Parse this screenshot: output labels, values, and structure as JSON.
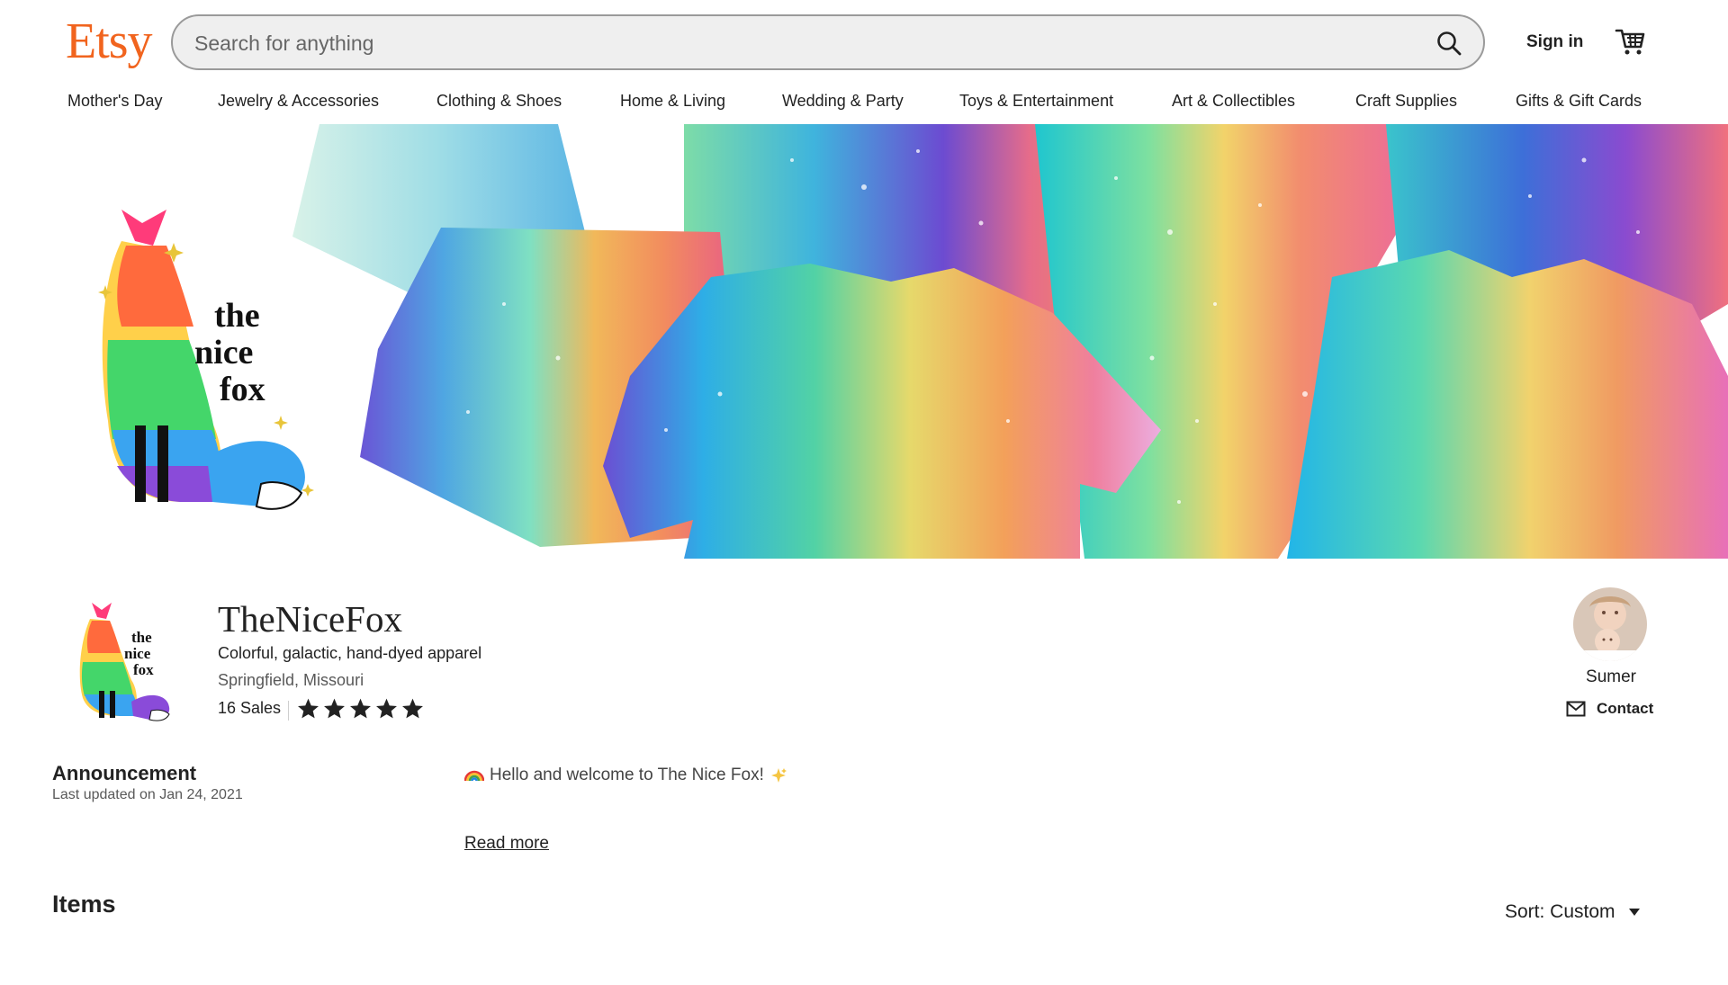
{
  "header": {
    "logo": "Etsy",
    "search_placeholder": "Search for anything",
    "sign_in": "Sign in"
  },
  "nav": {
    "items": [
      "Mother's Day",
      "Jewelry & Accessories",
      "Clothing & Shoes",
      "Home & Living",
      "Wedding & Party",
      "Toys & Entertainment",
      "Art & Collectibles",
      "Craft Supplies",
      "Gifts & Gift Cards"
    ]
  },
  "banner": {
    "logo_text": [
      "the",
      "nice",
      "fox"
    ]
  },
  "shop": {
    "name": "TheNiceFox",
    "tagline": "Colorful, galactic, hand-dyed apparel",
    "location": "Springfield, Missouri",
    "sales": "16 Sales",
    "rating_stars": 5
  },
  "owner": {
    "name": "Sumer",
    "contact_label": "Contact"
  },
  "announcement": {
    "title": "Announcement",
    "updated": "Last updated on Jan 24, 2021",
    "text": "Hello and welcome to The Nice Fox!",
    "read_more": "Read more"
  },
  "items": {
    "title": "Items",
    "sort_label": "Sort: Custom"
  },
  "colors": {
    "brand": "#f1641e",
    "text": "#222222",
    "muted": "#595959"
  }
}
